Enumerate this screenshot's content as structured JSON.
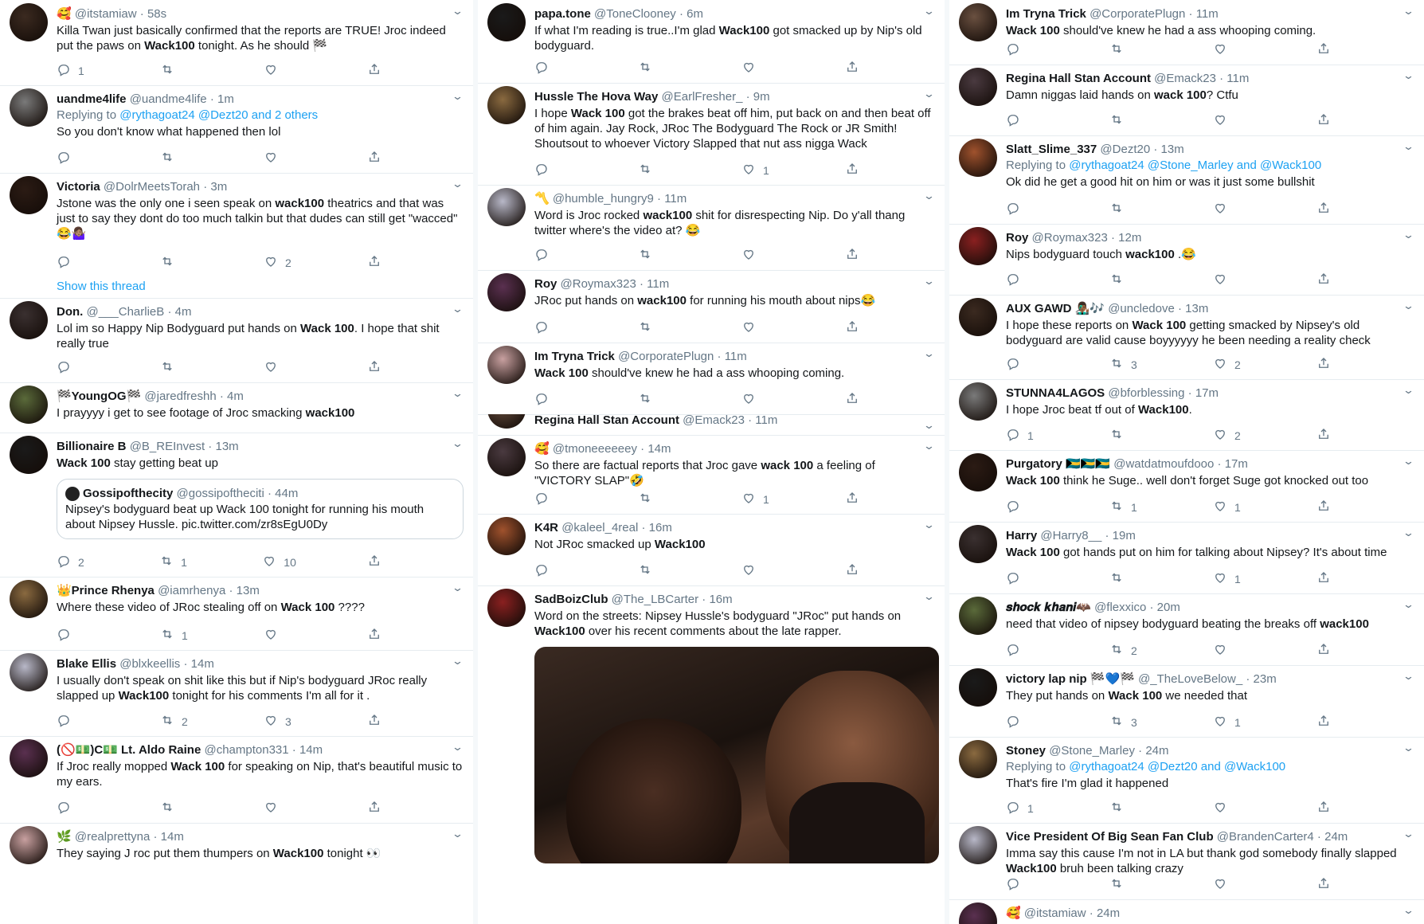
{
  "columns": [
    {
      "tweets": [
        {
          "name": "",
          "emoji": "🥰",
          "handle": "@itstamiaw",
          "time": "58s",
          "text": "Killa Twan just basically confirmed that the reports are TRUE! Jroc indeed put the paws on ",
          "bold": "Wack100",
          "text_after": " tonight. As he should 🏁",
          "reply": "1",
          "retweet": "",
          "like": ""
        },
        {
          "name": "uandme4life",
          "handle": "@uandme4life",
          "time": "1m",
          "replying_prefix": "Replying to ",
          "replying_links": "@rythagoat24 @Dezt20 and 2 others",
          "text": "So you don't know what happened then lol",
          "reply": "",
          "retweet": "",
          "like": ""
        },
        {
          "name": "Victoria",
          "handle": "@DolrMeetsTorah",
          "time": "3m",
          "text": "Jstone was the only one i seen speak on ",
          "bold": "wack100",
          "text_after": " theatrics and that was just to say they dont do too much talkin but that dudes can still get \"wacced\" 😂🤷🏽‍♀️",
          "reply": "",
          "retweet": "",
          "like": "2",
          "show_thread": "Show this thread"
        },
        {
          "name": "Don.",
          "handle": "@___CharlieB",
          "time": "4m",
          "text": "Lol im so Happy Nip Bodyguard put hands on ",
          "bold": "Wack 100",
          "text_after": ". I hope that shit really true",
          "reply": "",
          "retweet": "",
          "like": ""
        },
        {
          "name": "🏁YoungOG🏁",
          "handle": "@jaredfreshh",
          "time": "4m",
          "text": "I prayyyy i get to see footage of Jroc smacking ",
          "bold": "wack100",
          "text_after": "",
          "no_actions": true
        },
        {
          "name": "Billionaire B",
          "handle": "@B_REInvest",
          "time": "13m",
          "text": "",
          "bold": "Wack 100",
          "text_after": " stay getting beat up",
          "quote_name": "Gossipofthecity",
          "quote_handle": "@gossipoftheciti",
          "quote_time": "44m",
          "quote_text": "Nipsey's bodyguard beat up Wack 100 tonight for running his mouth about Nipsey Hussle. pic.twitter.com/zr8sEgU0Dy",
          "reply": "2",
          "retweet": "1",
          "like": "10"
        },
        {
          "name": "👑Prince Rhenya",
          "handle": "@iamrhenya",
          "time": "13m",
          "text": "Where these video of JRoc stealing off on ",
          "bold": "Wack 100",
          "text_after": " ????",
          "reply": "",
          "retweet": "1",
          "like": ""
        },
        {
          "name": "Blake Ellis",
          "handle": "@blxkeellis",
          "time": "14m",
          "text": "I usually don't speak on shit like this but if Nip's bodyguard JRoc really slapped up ",
          "bold": "Wack100",
          "text_after": " tonight for his comments I'm all for it .",
          "reply": "",
          "retweet": "2",
          "like": "3"
        },
        {
          "name": "(🚫💵)C💵 Lt. Aldo Raine",
          "handle": "@champton331",
          "time": "14m",
          "text": "If Jroc really mopped ",
          "bold": "Wack 100",
          "text_after": " for speaking on Nip, that's beautiful music to my ears.",
          "reply": "",
          "retweet": "",
          "like": ""
        },
        {
          "name": "",
          "emoji": "🌿",
          "handle": "@realprettyna",
          "time": "14m",
          "text": "They saying J roc put them thumpers on ",
          "bold": "Wack100",
          "text_after": " tonight 👀",
          "no_actions": true
        }
      ]
    },
    {
      "tweets": [
        {
          "name": "papa.tone",
          "handle": "@ToneClooney",
          "time": "6m",
          "text": "If what I'm reading is true..I'm glad ",
          "bold": "Wack100",
          "text_after": " got smacked up by Nip's old bodyguard.",
          "reply": "",
          "retweet": "",
          "like": ""
        },
        {
          "name": "Hussle The Hova Way",
          "handle": "@EarlFresher_",
          "time": "9m",
          "text": "I hope ",
          "bold": "Wack 100",
          "text_after": " got the brakes beat off him, put back on and then beat off of him again. Jay Rock, JRoc The Bodyguard The Rock or JR Smith! Shoutsout to whoever Victory Slapped that nut ass nigga Wack",
          "reply": "",
          "retweet": "",
          "like": "1"
        },
        {
          "name": "",
          "emoji": "〽️",
          "handle": "@humble_hungry9",
          "time": "11m",
          "text": "Word is Jroc rocked ",
          "bold": "wack100",
          "text_after": " shit for disrespecting Nip. Do y'all thang twitter where's the video at? 😂",
          "reply": "",
          "retweet": "",
          "like": ""
        },
        {
          "name": "Roy",
          "handle": "@Roymax323",
          "time": "11m",
          "text": "JRoc put hands on ",
          "bold": "wack100",
          "text_after": " for running his mouth about nips😂",
          "reply": "",
          "retweet": "",
          "like": ""
        },
        {
          "name": "Im Tryna Trick",
          "handle": "@CorporatePlugn",
          "time": "11m",
          "text": "",
          "bold": "Wack 100",
          "text_after": " should've knew he had a ass whooping coming.",
          "reply": "",
          "retweet": "",
          "like": ""
        },
        {
          "name": "Regina Hall Stan Account",
          "handle": "@Emack23",
          "time": "11m",
          "clipped": true
        },
        {
          "name": "",
          "emoji": "🥰",
          "handle": "@tmoneeeeeey",
          "time": "14m",
          "text": "So there are factual reports that Jroc gave ",
          "bold": "wack 100",
          "text_after": " a feeling of \"VICTORY SLAP\"🤣",
          "reply": "",
          "retweet": "",
          "like": "1"
        },
        {
          "name": "K4R",
          "handle": "@kaleel_4real",
          "time": "16m",
          "text": "Not JRoc smacked up ",
          "bold": "Wack100",
          "text_after": "",
          "reply": "",
          "retweet": "",
          "like": ""
        },
        {
          "name": "SadBoizClub",
          "handle": "@The_LBCarter",
          "time": "16m",
          "text": "Word on the streets: Nipsey Hussle's bodyguard \"JRoc\" put hands on ",
          "bold": "Wack100",
          "text_after": " over his recent comments about the late rapper.",
          "has_media": true
        }
      ]
    },
    {
      "tweets": [
        {
          "name": "Im Tryna Trick",
          "handle": "@CorporatePlugn",
          "time": "11m",
          "text": "",
          "bold": "Wack 100",
          "text_after": " should've knew he had a ass whooping coming.",
          "reply": "",
          "retweet": "",
          "like": ""
        },
        {
          "name": "Regina Hall Stan Account",
          "handle": "@Emack23",
          "time": "11m",
          "text": "Damn niggas laid hands on ",
          "bold": "wack 100",
          "text_after": "? Ctfu",
          "reply": "",
          "retweet": "",
          "like": ""
        },
        {
          "name": "Slatt_Slime_337",
          "handle": "@Dezt20",
          "time": "13m",
          "replying_prefix": "Replying to ",
          "replying_links": "@rythagoat24 @Stone_Marley and @Wack100",
          "text": "Ok did he get a good hit on him or was it just some bullshit",
          "reply": "",
          "retweet": "",
          "like": ""
        },
        {
          "name": "Roy",
          "handle": "@Roymax323",
          "time": "12m",
          "text": "Nips bodyguard touch ",
          "bold": "wack100",
          "text_after": " .😂",
          "reply": "",
          "retweet": "",
          "like": ""
        },
        {
          "name": "AUX GAWD 👨🏾‍🎤🎶",
          "handle": "@uncledove",
          "time": "13m",
          "text": "I hope these reports on ",
          "bold": "Wack 100",
          "text_after": " getting smacked by Nipsey's old bodyguard are valid cause boyyyyyy he been needing a reality check",
          "reply": "",
          "retweet": "3",
          "like": "2"
        },
        {
          "name": "STUNNA4LAGOS",
          "handle": "@bforblessing",
          "time": "17m",
          "text": "I hope Jroc beat tf out of ",
          "bold": "Wack100",
          "text_after": ".",
          "reply": "1",
          "retweet": "",
          "like": "2"
        },
        {
          "name": "Purgatory 🇧🇸🇧🇸🇧🇸",
          "handle": "@watdatmoufdooo",
          "time": "17m",
          "text": "",
          "bold": "Wack 100",
          "text_after": " think he Suge.. well don't forget Suge got knocked out too",
          "reply": "",
          "retweet": "1",
          "like": "1"
        },
        {
          "name": "Harry",
          "handle": "@Harry8__",
          "time": "19m",
          "text": "",
          "bold": "Wack 100",
          "text_after": " got hands put on him for talking about Nipsey? It's about time",
          "reply": "",
          "retweet": "",
          "like": "1"
        },
        {
          "name": "𝒔𝒉𝒐𝒄𝒌 𝒌𝒉𝒂𝒏𝒊🦇",
          "handle": "@flexxico",
          "time": "20m",
          "text": "need that video of nipsey bodyguard beating the breaks off ",
          "bold": "wack100",
          "text_after": "",
          "reply": "",
          "retweet": "2",
          "like": ""
        },
        {
          "name": "victory lap nip 🏁💙🏁",
          "handle": "@_TheLoveBelow_",
          "time": "23m",
          "text": "They put hands on ",
          "bold": "Wack 100",
          "text_after": " we needed that",
          "reply": "",
          "retweet": "3",
          "like": "1"
        },
        {
          "name": "Stoney",
          "handle": "@Stone_Marley",
          "time": "24m",
          "replying_prefix": "Replying to ",
          "replying_links": "@rythagoat24 @Dezt20 and @Wack100",
          "text": "That's fire I'm glad it happened",
          "reply": "1",
          "retweet": "",
          "like": ""
        },
        {
          "name": "Vice President Of Big Sean Fan Club",
          "handle": "@BrandenCarter4",
          "time": "24m",
          "text": "Imma say this cause I'm not in LA but thank god somebody finally slapped ",
          "bold": "Wack100",
          "text_after": " bruh been talking crazy",
          "reply": "",
          "retweet": "",
          "like": ""
        },
        {
          "name": "",
          "emoji": "🥰",
          "handle": "@itstamiaw",
          "time": "24m",
          "clipped": true
        }
      ]
    }
  ],
  "colors": {
    "link": "#1da1f2",
    "muted": "#657786",
    "border": "#e6ecf0",
    "text": "#14171a"
  },
  "icons": [
    "reply-icon",
    "retweet-icon",
    "like-icon",
    "share-icon",
    "chevron-down-icon"
  ]
}
